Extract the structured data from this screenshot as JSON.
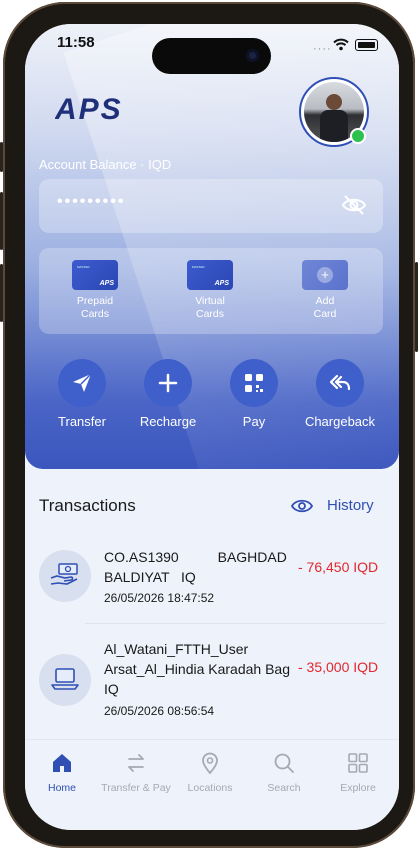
{
  "status_bar": {
    "time": "11:58",
    "signal": "····"
  },
  "header": {
    "logo_text": "APS"
  },
  "balance": {
    "label": "Account Balance · IQD",
    "masked_value": "•••••••••"
  },
  "cards": [
    {
      "line1": "Prepaid",
      "line2": "Cards",
      "brand": "APS",
      "tiny": "MASTER"
    },
    {
      "line1": "Virtual",
      "line2": "Cards",
      "brand": "APS",
      "tiny": "MASTER"
    },
    {
      "line1": "Add",
      "line2": "Card"
    }
  ],
  "actions": [
    {
      "label": "Transfer",
      "icon": "send-icon"
    },
    {
      "label": "Recharge",
      "icon": "plus-icon"
    },
    {
      "label": "Pay",
      "icon": "qr-icon"
    },
    {
      "label": "Chargeback",
      "icon": "undo-icon"
    }
  ],
  "transactions_section": {
    "title": "Transactions",
    "history_label": "History"
  },
  "transactions": [
    {
      "line1": "CO.AS1390          BAGHDAD",
      "line2": "BALDIYAT   IQ",
      "date": "26/05/2026 18:47:52",
      "amount": "- 76,450 IQD",
      "icon": "cash-hand-icon"
    },
    {
      "line1": "Al_Watani_FTTH_User",
      "line2": "Arsat_Al_Hindia Karadah Bag",
      "line3": "IQ",
      "date": "26/05/2026 08:56:54",
      "amount": "- 35,000 IQD",
      "icon": "laptop-icon"
    }
  ],
  "tabs": [
    {
      "label": "Home",
      "icon": "home-icon",
      "active": true
    },
    {
      "label": "Transfer & Pay",
      "icon": "transfer-icon"
    },
    {
      "label": "Locations",
      "icon": "location-pin-icon"
    },
    {
      "label": "Search",
      "icon": "search-icon"
    },
    {
      "label": "Explore",
      "icon": "grid-icon"
    }
  ],
  "colors": {
    "brand": "#2f4fb5",
    "negative": "#e0282e",
    "online": "#2ec04f"
  }
}
